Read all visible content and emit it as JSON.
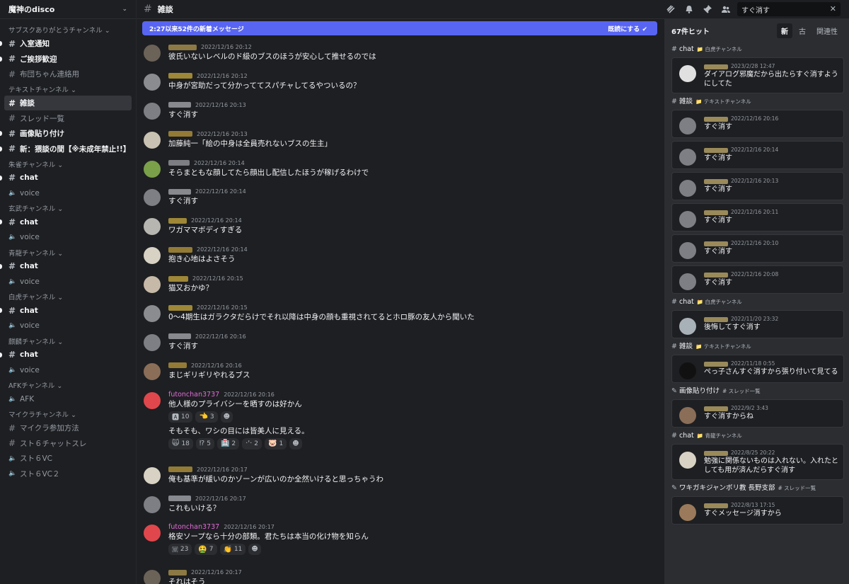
{
  "server": {
    "name": "魔神のdisco"
  },
  "channel_header": {
    "title": "雑談"
  },
  "search": {
    "query": "すぐ消す",
    "count_label": "67件ヒット",
    "tabs": [
      "新",
      "古",
      "関連性"
    ]
  },
  "newbar": {
    "left": "2:27以来52件の新着メッセージ",
    "right": "既読にする"
  },
  "categories": [
    {
      "label": "サブスクありがとうチャンネル ⌄",
      "channels": [
        {
          "label": "入室通知",
          "type": "text",
          "state": "unread"
        },
        {
          "label": "ご挨拶歓迎",
          "type": "text",
          "state": "unread"
        },
        {
          "label": "布団ちゃん連絡用",
          "type": "text",
          "state": "normal"
        }
      ]
    },
    {
      "label": "テキストチャンネル ⌄",
      "channels": [
        {
          "label": "雑談",
          "type": "text",
          "state": "active"
        },
        {
          "label": "スレッド一覧",
          "type": "text",
          "state": "normal"
        },
        {
          "label": "画像貼り付け",
          "type": "text",
          "state": "unread"
        },
        {
          "label": "新：猥談の間【※未成年禁止!!】",
          "type": "text",
          "state": "unread"
        }
      ]
    },
    {
      "label": "朱雀チャンネル ⌄",
      "channels": [
        {
          "label": "chat",
          "type": "text",
          "state": "unread"
        },
        {
          "label": "voice",
          "type": "voice",
          "state": "normal"
        }
      ]
    },
    {
      "label": "玄武チャンネル ⌄",
      "channels": [
        {
          "label": "chat",
          "type": "text",
          "state": "unread"
        },
        {
          "label": "voice",
          "type": "voice",
          "state": "normal"
        }
      ]
    },
    {
      "label": "青龍チャンネル ⌄",
      "channels": [
        {
          "label": "chat",
          "type": "text",
          "state": "unread"
        },
        {
          "label": "voice",
          "type": "voice",
          "state": "normal"
        }
      ]
    },
    {
      "label": "白虎チャンネル ⌄",
      "channels": [
        {
          "label": "chat",
          "type": "text",
          "state": "unread"
        },
        {
          "label": "voice",
          "type": "voice",
          "state": "normal"
        }
      ]
    },
    {
      "label": "麒麟チャンネル ⌄",
      "channels": [
        {
          "label": "chat",
          "type": "text",
          "state": "unread"
        },
        {
          "label": "voice",
          "type": "voice",
          "state": "normal"
        }
      ]
    },
    {
      "label": "AFKチャンネル ⌄",
      "channels": [
        {
          "label": "AFK",
          "type": "voice",
          "state": "normal"
        }
      ]
    },
    {
      "label": "マイクラチャンネル ⌄",
      "channels": [
        {
          "label": "マイクラ参加方法",
          "type": "text",
          "state": "normal"
        },
        {
          "label": "スト６チャットスレ",
          "type": "text",
          "state": "normal"
        },
        {
          "label": "スト６VC",
          "type": "voice",
          "state": "normal"
        },
        {
          "label": "スト６VC２",
          "type": "voice",
          "state": "normal"
        }
      ]
    }
  ],
  "messages": [
    {
      "time": "2022/12/16 20:12",
      "text": "彼氏いないレベルのド級のブスのほうが安心して推せるのでは",
      "av": "#6b6258",
      "nm": "#a08a4a"
    },
    {
      "time": "2022/12/16 20:12",
      "text": "中身が宮助だって分かっててスパチャしてるやついるの？",
      "av": "#8a8c90",
      "nm": "#b59a3a"
    },
    {
      "time": "2022/12/16 20:13",
      "text": "すぐ消す",
      "av": "#7d7f85",
      "nm": "#9a9ca2"
    },
    {
      "time": "2022/12/16 20:13",
      "text": "加藤純一「絵の中身は全員売れないブスの生主」",
      "av": "#c9c2b2",
      "nm": "#a88c3a"
    },
    {
      "time": "2022/12/16 20:14",
      "text": "そらまともな顔してたら顔出し配信したほうが稼げるわけで",
      "av": "#7aa04a",
      "nm": "#8d8f95"
    },
    {
      "time": "2022/12/16 20:14",
      "text": "すぐ消す",
      "av": "#7d7f85",
      "nm": "#9a9ca2"
    },
    {
      "time": "2022/12/16 20:14",
      "text": "ワガママボディすぎる",
      "av": "#b8b6b0",
      "nm": "#b59a3a"
    },
    {
      "time": "2022/12/16 20:14",
      "text": "抱き心地はよさそう",
      "av": "#d8d2c4",
      "nm": "#a88c3a"
    },
    {
      "time": "2022/12/16 20:15",
      "text": "猫又おかゆ？",
      "av": "#c7b9a8",
      "nm": "#b59a3a"
    },
    {
      "time": "2022/12/16 20:15",
      "text": "0〜4期生はガラクタだらけでそれ以降は中身の顔も重視されてるとホロ豚の友人から聞いた",
      "av": "#8a8c90",
      "nm": "#b59a3a"
    },
    {
      "time": "2022/12/16 20:16",
      "text": "すぐ消す",
      "av": "#7d7f85",
      "nm": "#9a9ca2"
    },
    {
      "time": "2022/12/16 20:16",
      "text": "まじギリギリやれるブス",
      "av": "#8a6e58",
      "nm": "#a88c3a"
    }
  ],
  "futon_msg_1": {
    "author": "futonchan3737",
    "time": "2022/12/16 20:16",
    "line1": "他人様のプライバシーを晒すのは好かん",
    "reacts1": [
      {
        "em": "🅰",
        "n": "10"
      },
      {
        "em": "👈",
        "n": "3"
      }
    ],
    "line2": "そもそも、ワシの目には皆美人に見える。",
    "reacts2": [
      {
        "em": "🙀",
        "n": "18"
      },
      {
        "em": "⁉",
        "n": "5"
      },
      {
        "em": "🏥",
        "n": "2"
      },
      {
        "em": "·'·",
        "n": "2"
      },
      {
        "em": "🐷",
        "n": "1"
      }
    ]
  },
  "messages2": [
    {
      "time": "2022/12/16 20:17",
      "text": "俺も基準が緩いのかゾーンが広いのか全然いけると思っちゃうわ",
      "av": "#d8d2c4",
      "nm": "#a88c3a"
    },
    {
      "time": "2022/12/16 20:17",
      "text": "これもいける？",
      "av": "#7d7f85",
      "nm": "#9a9ca2"
    }
  ],
  "futon_msg_2": {
    "author": "futonchan3737",
    "time": "2022/12/16 20:17",
    "line1": "格安ソープなら十分の部類。君たちは本当の化け物を知らん",
    "reacts1": [
      {
        "em": "🇼",
        "n": "23"
      },
      {
        "em": "🤮",
        "n": "7"
      },
      {
        "em": "👏",
        "n": "11"
      }
    ]
  },
  "last_msg": {
    "time": "2022/12/16 20:17",
    "text": "それはそう"
  },
  "results": [
    {
      "grp_icon": "#",
      "grp": "chat",
      "grp_cat": "📁 白虎チャンネル",
      "time": "2023/2/28 12:47",
      "text": "ダイアログ邪魔だから出たらすぐ消すようにしてた",
      "av": "#e0e0e0"
    },
    {
      "grp_icon": "#",
      "grp": "雑談",
      "grp_cat": "📁 テキストチャンネル",
      "time": "2022/12/16 20:16",
      "text": "すぐ消す",
      "av": "#7d7f85"
    },
    {
      "time": "2022/12/16 20:14",
      "text": "すぐ消す",
      "av": "#7d7f85"
    },
    {
      "time": "2022/12/16 20:13",
      "text": "すぐ消す",
      "av": "#7d7f85"
    },
    {
      "time": "2022/12/16 20:11",
      "text": "すぐ消す",
      "av": "#7d7f85"
    },
    {
      "time": "2022/12/16 20:10",
      "text": "すぐ消す",
      "av": "#7d7f85"
    },
    {
      "time": "2022/12/16 20:08",
      "text": "すぐ消す",
      "av": "#7d7f85"
    },
    {
      "grp_icon": "#",
      "grp": "chat",
      "grp_cat": "📁 白虎チャンネル",
      "time": "2022/11/20 23:32",
      "text": "後悔してすぐ消す",
      "av": "#a8b0b8"
    },
    {
      "grp_icon": "#",
      "grp": "雑談",
      "grp_cat": "📁 テキストチャンネル",
      "time": "2022/11/18 0:55",
      "text": "ぺっ子さんすぐ消すから張り付いて見てる",
      "av": "#111111"
    },
    {
      "grp_icon": "✎",
      "grp": "画像貼り付け",
      "grp_cat": "# スレッド一覧",
      "time": "2022/9/2 3:43",
      "text": "すぐ消すからね",
      "av": "#8a6e58"
    },
    {
      "grp_icon": "#",
      "grp": "chat",
      "grp_cat": "📁 青龍チャンネル",
      "time": "2022/8/25 20:22",
      "text": "勉強に関係ないものは入れない。入れたとしても用が済んだらすぐ消す",
      "av": "#d8d2c4"
    },
    {
      "grp_icon": "✎",
      "grp": "ワキガキジャンボリ教 長野支部",
      "grp_cat": "# スレッド一覧",
      "time": "2022/8/13 17:15",
      "text": "すぐメッセージ消すから",
      "av": "#9a7a5a"
    }
  ],
  "colors": {
    "accent": "#5865f2",
    "bg": "#1e1f22",
    "panel": "#2b2d31",
    "futon_name": "#e26bd9",
    "futon_avatar": "#e0474c"
  },
  "icons": [
    "chevron-down-icon",
    "hash-icon",
    "speaker-icon",
    "threads-icon",
    "bell-icon",
    "pin-icon",
    "members-icon",
    "search-clear-icon",
    "mark-read-icon"
  ]
}
